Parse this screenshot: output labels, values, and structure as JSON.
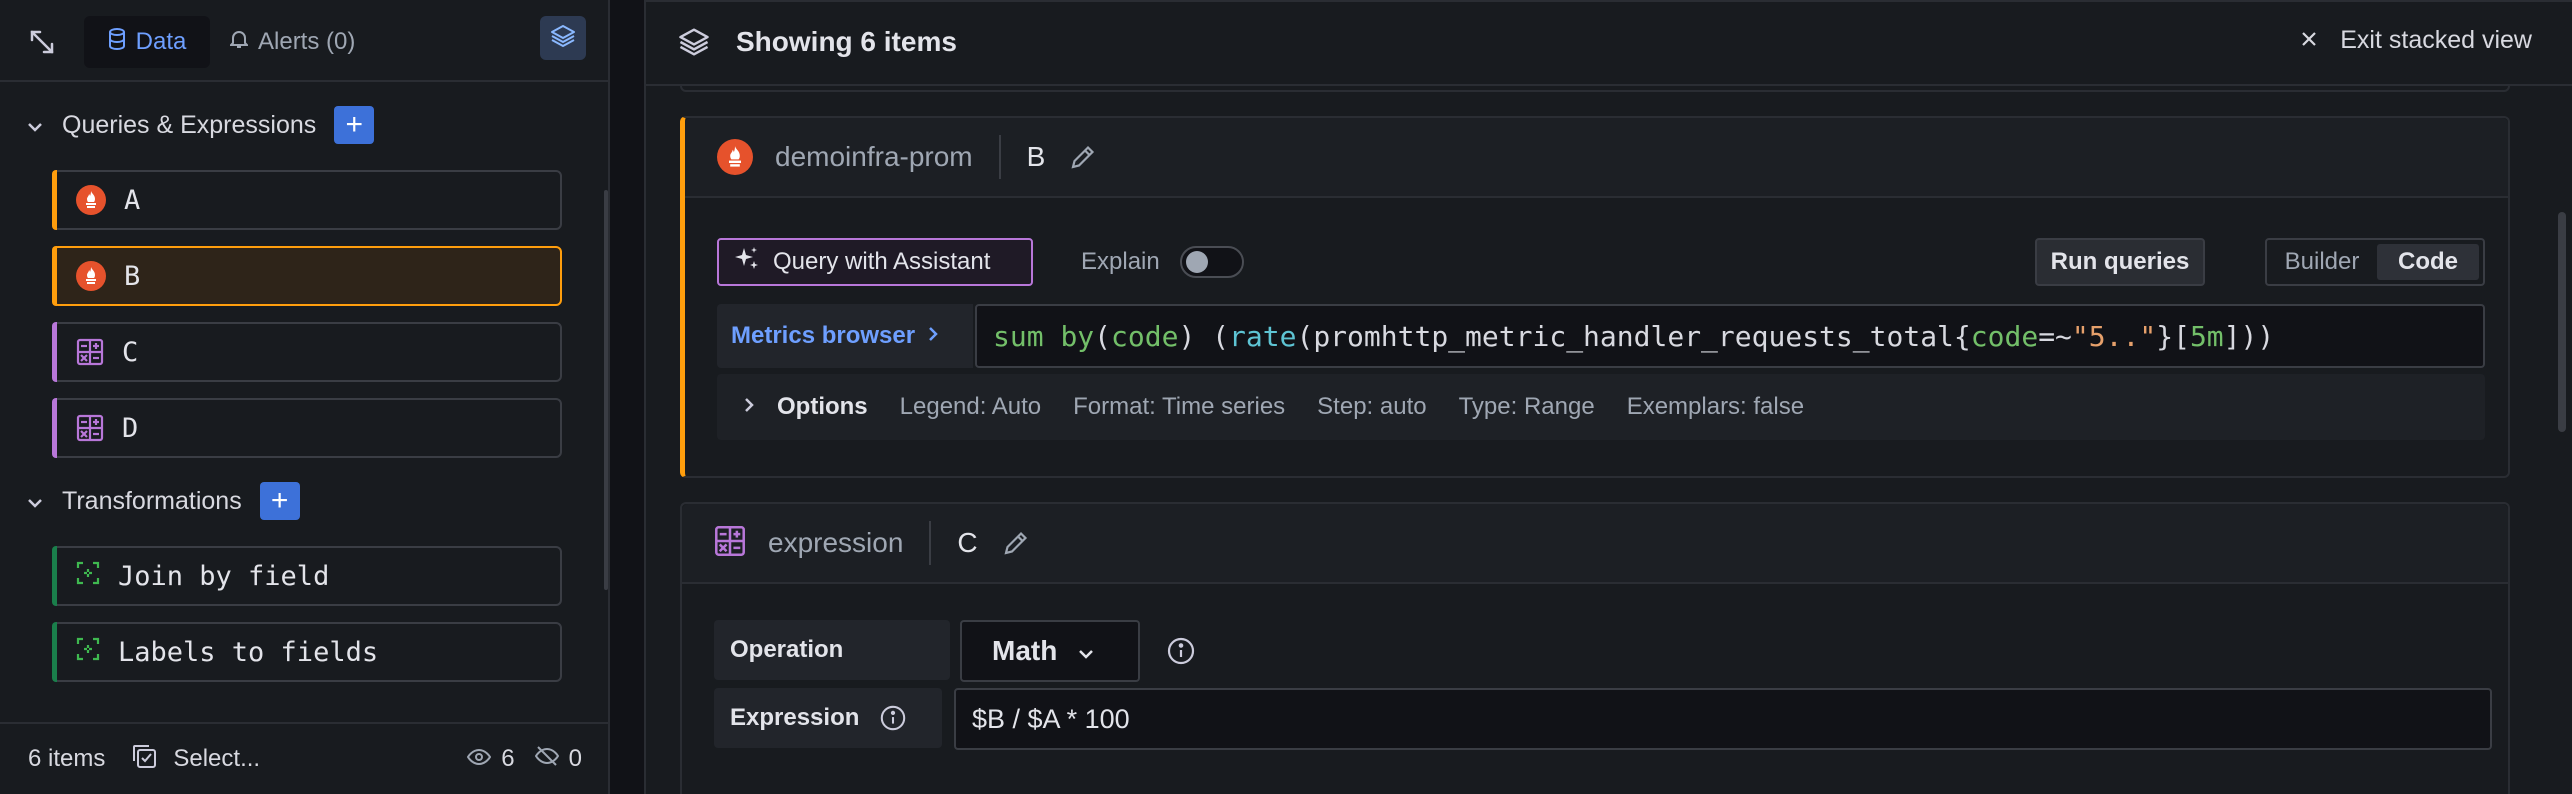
{
  "sidebar": {
    "tabs": {
      "data": "Data",
      "alerts": "Alerts (0)"
    },
    "queries_heading": "Queries & Expressions",
    "queries": [
      {
        "label": "A",
        "kind": "prometheus",
        "active": false
      },
      {
        "label": "B",
        "kind": "prometheus",
        "active": true
      },
      {
        "label": "C",
        "kind": "expression",
        "active": false
      },
      {
        "label": "D",
        "kind": "expression",
        "active": false
      }
    ],
    "transformations_heading": "Transformations",
    "transformations": [
      {
        "label": "Join by field"
      },
      {
        "label": "Labels to fields"
      }
    ],
    "footer": {
      "count": "6 items",
      "select": "Select...",
      "visible": "6",
      "hidden": "0"
    }
  },
  "main": {
    "title": "Showing 6 items",
    "exit_label": "Exit stacked view",
    "query_card": {
      "datasource": "demoinfra-prom",
      "ref_id": "B",
      "assistant_label": "Query with Assistant",
      "explain_label": "Explain",
      "run_label": "Run queries",
      "mode_builder": "Builder",
      "mode_code": "Code",
      "metrics_browser": "Metrics browser",
      "query_tokens": {
        "t1": "sum",
        "t2": " ",
        "t3": "by",
        "t4": "(",
        "t5": "code",
        "t6": ") (",
        "t7": "rate",
        "t8": "(promhttp_metric_handler_requests_total{",
        "t9": "code",
        "t10": "=~",
        "t11": "\"5..\"",
        "t12": "}[",
        "t13": "5m",
        "t14": "]))"
      },
      "options_title": "Options",
      "options": [
        "Legend: Auto",
        "Format: Time series",
        "Step: auto",
        "Type: Range",
        "Exemplars: false"
      ]
    },
    "expression_card": {
      "datasource": "expression",
      "ref_id": "C",
      "operation_label": "Operation",
      "operation_value": "Math",
      "expression_label": "Expression",
      "expression_value": "$B / $A * 100"
    }
  },
  "colors": {
    "accent_blue": "#3d71d9",
    "active_orange": "#ff9e0d",
    "prometheus": "#e6522c",
    "expression_purple": "#b877d9",
    "transform_green": "#1a7f4b"
  }
}
